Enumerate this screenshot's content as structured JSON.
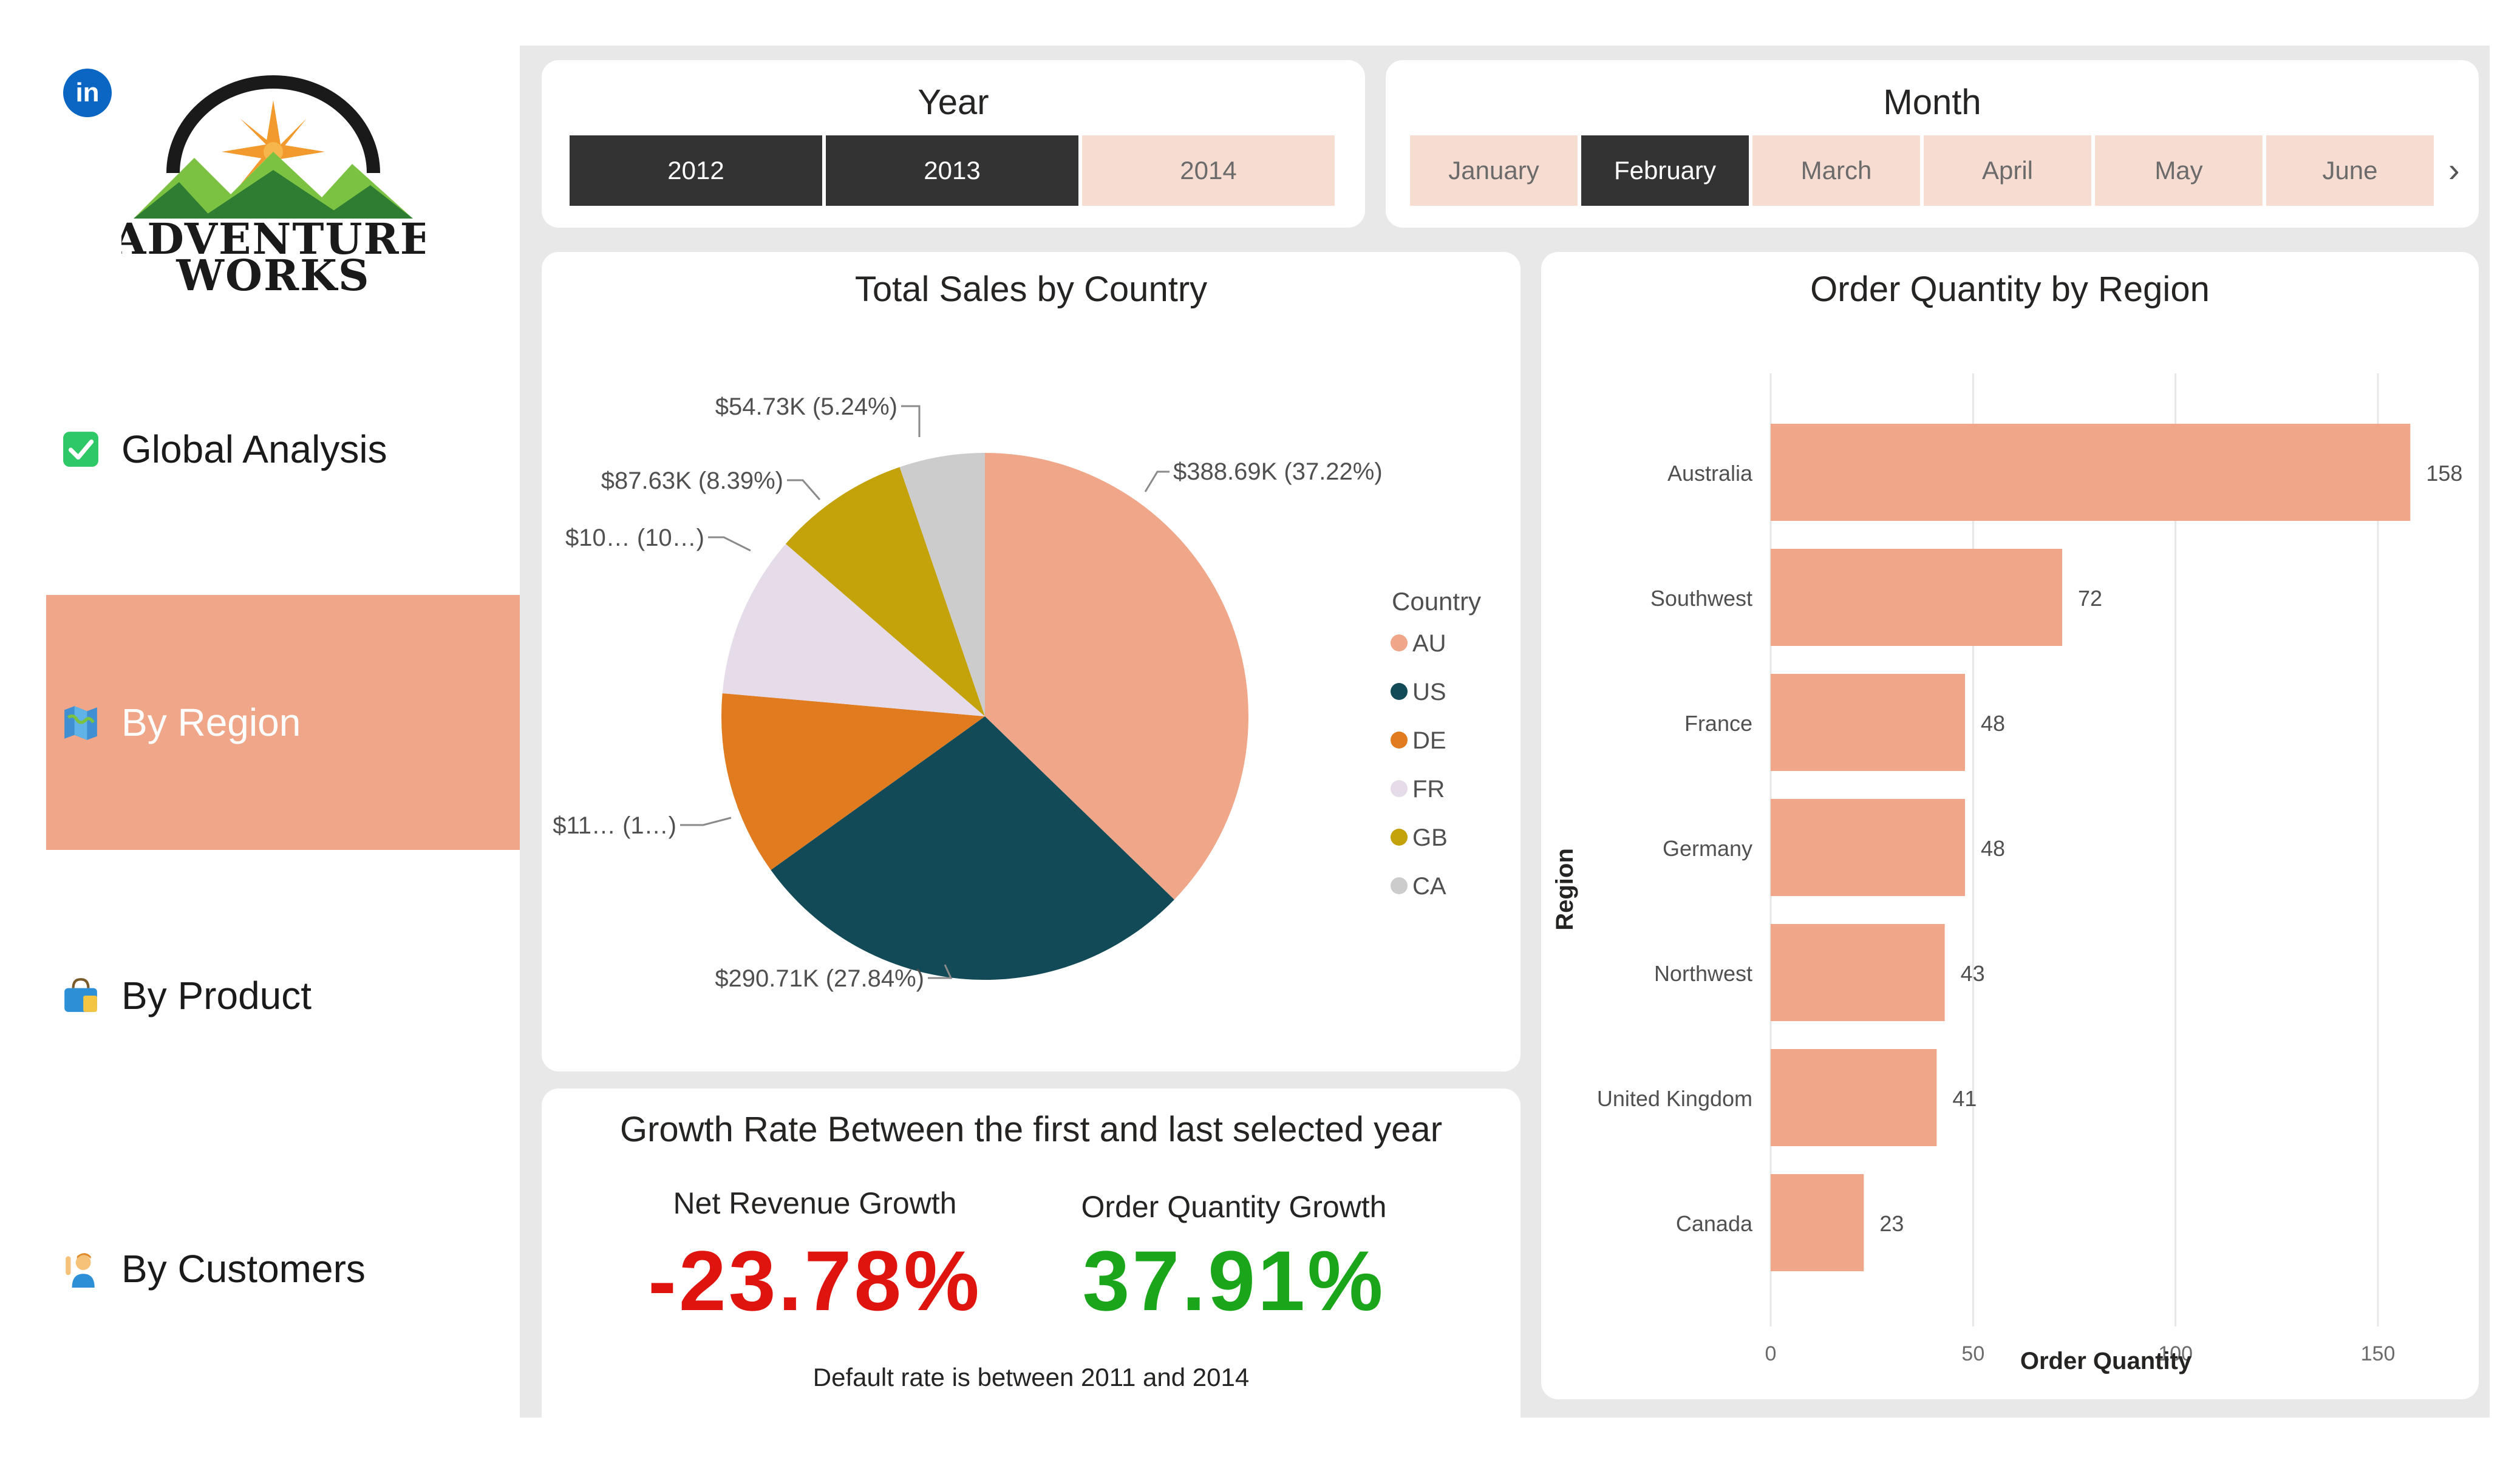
{
  "brand": {
    "name_line1": "Adventure",
    "name_line2": "Works",
    "linkedin_label": "in",
    "colors": {
      "sun": "#f29a2e",
      "mountain_dark": "#2e7d32",
      "mountain_light": "#7cc242",
      "arc": "#1a1a1a"
    }
  },
  "sidebar": {
    "items": [
      {
        "label": "Global Analysis",
        "icon": "checkbox-icon",
        "active": false
      },
      {
        "label": "By Region",
        "icon": "map-icon",
        "active": true
      },
      {
        "label": "By Product",
        "icon": "shopping-bag-icon",
        "active": false
      },
      {
        "label": "By Customers",
        "icon": "person-raising-hand-icon",
        "active": false
      }
    ],
    "active_color": "#f0a689"
  },
  "year_slicer": {
    "title": "Year",
    "options": [
      {
        "label": "2012",
        "selected": true
      },
      {
        "label": "2013",
        "selected": true
      },
      {
        "label": "2014",
        "selected": false
      }
    ]
  },
  "month_slicer": {
    "title": "Month",
    "options": [
      {
        "label": "January",
        "selected": false
      },
      {
        "label": "February",
        "selected": true
      },
      {
        "label": "March",
        "selected": false
      },
      {
        "label": "April",
        "selected": false
      },
      {
        "label": "May",
        "selected": false
      },
      {
        "label": "June",
        "selected": false
      }
    ],
    "next_icon": "chevron-right-icon"
  },
  "sales_by_country": {
    "title": "Total Sales by Country",
    "legend_title": "Country",
    "slice_labels": [
      "$388.69K (37.22%)",
      "$290.71K (27.84%)",
      "$11… (1…)",
      "$10… (10…)",
      "$87.63K (8.39%)",
      "$54.73K (5.24%)"
    ]
  },
  "order_qty_by_region": {
    "title": "Order Quantity by Region",
    "ylabel": "Region",
    "xlabel": "Order Quantity",
    "ticks": [
      "0",
      "50",
      "100",
      "150"
    ]
  },
  "growth": {
    "title": "Growth Rate Between the first and last selected year",
    "net_revenue_label": "Net Revenue Growth",
    "net_revenue_value": "-23.78%",
    "net_revenue_color": "#e0140e",
    "order_qty_label": "Order Quantity Growth",
    "order_qty_value": "37.91%",
    "order_qty_color": "#1aa51a",
    "note": "Default rate is between 2011 and 2014"
  },
  "chart_data": [
    {
      "type": "pie",
      "title": "Total Sales by Country",
      "legend_title": "Country",
      "legend_position": "right",
      "categories": [
        "AU",
        "US",
        "DE",
        "FR",
        "GB",
        "CA"
      ],
      "values": [
        388.69,
        290.71,
        118.0,
        104.0,
        87.63,
        54.73
      ],
      "value_unit": "$K",
      "percent": [
        37.22,
        27.84,
        11.3,
        10.0,
        8.39,
        5.24
      ],
      "colors": [
        "#f0a689",
        "#124b57",
        "#e07b1f",
        "#e6dbe8",
        "#c4a20a",
        "#cccccc"
      ]
    },
    {
      "type": "bar",
      "orientation": "horizontal",
      "title": "Order Quantity by Region",
      "categories": [
        "Australia",
        "Southwest",
        "France",
        "Germany",
        "Northwest",
        "United Kingdom",
        "Canada"
      ],
      "values": [
        158,
        72,
        48,
        48,
        43,
        41,
        23
      ],
      "xlabel": "Order Quantity",
      "ylabel": "Region",
      "xlim": [
        0,
        175
      ],
      "grid": true,
      "bar_color": "#f0a689"
    }
  ]
}
